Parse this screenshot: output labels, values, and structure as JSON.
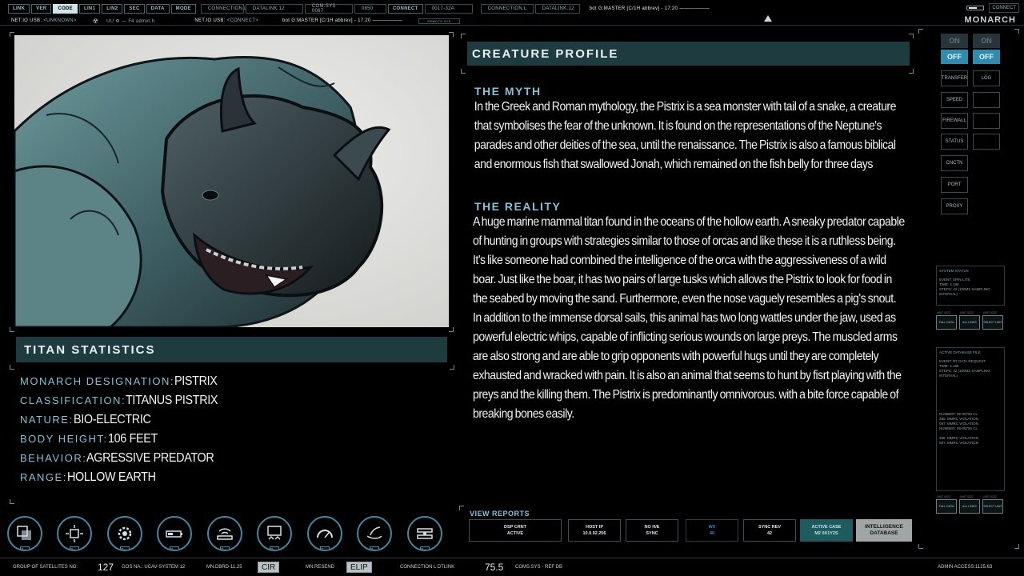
{
  "topbar": {
    "tabs": [
      "LINK",
      "VER",
      "CODE",
      "LIN1",
      "LIN2",
      "SEC",
      "DATA",
      "MODE"
    ],
    "active_tab": "CODE",
    "cells": [
      "CONNECTION.L",
      "DATALINK.12",
      "COM.SYS 0067",
      "0850",
      "CONNECT",
      "0017-32A"
    ],
    "cells_mid": [
      "CONNECTION.L",
      "DATALINK.12"
    ],
    "status_text": "bot G:MASTER [C/1H abbrev] - 17:20 ——————",
    "connect_label": "CONNECT",
    "row2": {
      "usb_label": "NET.IO USB:",
      "usb_value": "<UNKNOWN>",
      "radiation_glyph": "☢",
      "user_text": "UU  ⚙ — F4 admin.h",
      "usb2_label": "NET.IO USB:",
      "usb2_value": "<CONNECT>",
      "status_text": "bot G:MASTER [C/1H abbrev] - 17:20 ——————",
      "small_box": "REMOTE SYS"
    },
    "brand": "MONARCH"
  },
  "titan_stats": {
    "header": "TITAN STATISTICS",
    "rows": [
      {
        "label": "MONARCH DESIGNATION:",
        "value": "PISTRIX"
      },
      {
        "label": "CLASSIFICATION:",
        "value": "TITANUS PISTRIX"
      },
      {
        "label": "NATURE:",
        "value": "BIO-ELECTRIC"
      },
      {
        "label": "BODY HEIGHT:",
        "value": "106 FEET"
      },
      {
        "label": "BEHAVIOR:",
        "value": "AGRESSIVE PREDATOR"
      },
      {
        "label": "RANGE:",
        "value": "HOLLOW EARTH"
      }
    ]
  },
  "profile": {
    "header": "CREATURE PROFILE",
    "myth_title": "THE MYTH",
    "myth_text": "In the Greek and Roman mythology, the Pistrix is a sea monster with tail of a snake, a creature that symbolises the fear of the unknown. It is found on the representations of the Neptune's parades and other deities of the sea, until the renaissance. The Pistrix is also a famous biblical and enormous fish that swallowed Jonah, which remained on the fish belly for three days",
    "reality_title": "THE REALITY",
    "reality_text": "A huge marine mammal titan found in the oceans of the hollow earth. A sneaky predator capable of hunting in groups with strategies similar to those of orcas and like these it is a ruthless being. It's like someone had combined the intelligence of the orca with the aggressiveness of a wild boar. Just like the boar, it has two pairs of large tusks which allows the Pistrix to look for food in the seabed by moving the sand. Furthermore, even the nose vaguely resembles a pig's snout. In addition to the immense dorsal sails, this animal has two long wattles under the jaw, used as powerful electric whips, capable of inflicting serious wounds on large preys. The muscled arms are also strong and are able to grip opponents with powerful hugs until they are completely exhausted and wracked with pain. It is also an animal that seems to hunt by fisrt playing with the preys and the killing them. The Pistrix is predominantly omnivorous. with a bite force capable of breaking bones easily."
  },
  "controls": {
    "toggles": [
      {
        "on": "ON",
        "off": "OFF"
      },
      {
        "on": "ON",
        "off": "OFF"
      }
    ],
    "buttons": [
      "TRANSFER",
      "LOG",
      "SPEED",
      "FIREWALL",
      "STATUS",
      "CNCTN",
      "PORT",
      "PROXY"
    ],
    "info1": {
      "title": "SYSTEM STATUS",
      "lines": [
        "EVENT:      SPIN-LITE",
        "TIME:        4.185",
        "STEPS:      42 (100MS SAMPLING",
        "INTERVAL)"
      ]
    },
    "mini1": [
      "FULL DATA",
      "ALL LINKS",
      "SELECT UNIT"
    ],
    "mini_caps": "UNIT 0322",
    "info2": {
      "title": "ACTIVE DATABASE FILE",
      "lines": [
        "EVENT:      RT DATA REQUEST",
        "TIME:        4.185",
        "STEPS:      42 (100MS SAMPLING",
        "INTERVAL)",
        "",
        "",
        "",
        "",
        "",
        "",
        "NUMBER:   05-08755 CL",
        "385:          MMRC VIOLATION",
        "087:          MMRC VIOLATION",
        "NUMBER:   05-08756 CL",
        "",
        "385:          MMRC VIOLATION",
        "087:          MMRC VIOLATION"
      ]
    },
    "mini2": [
      "FULL DATA",
      "ALL LINKS",
      "SELECT UNIT"
    ]
  },
  "bottom_icons": {
    "labels": [
      "01",
      "02",
      "03",
      "04",
      "05",
      "06",
      "07",
      "08",
      "09"
    ]
  },
  "reports": {
    "title": "VIEW REPORTS",
    "items": [
      {
        "l1": "DSP CRNT",
        "l2": "ACTIVE",
        "style": ""
      },
      {
        "l1": "HOST IP",
        "l2": "10.0.92.256",
        "style": ""
      },
      {
        "l1": "NO H/E",
        "l2": "SYNC",
        "style": ""
      },
      {
        "l1": "WX",
        "l2": "40",
        "style": "dim"
      },
      {
        "l1": "SYNC REV",
        "l2": "42",
        "style": ""
      },
      {
        "l1": "ACTIVE CASE",
        "l2": "M2 0X1Y2S",
        "style": "teal"
      },
      {
        "l1": "INTELLIGENCE",
        "l2": "DATABASE",
        "style": "grey"
      }
    ]
  },
  "bottombar": {
    "satellites_label": "GROUP OF SATELLITES NO:",
    "satellites_value": "127",
    "gos_label": "GOS NA.: UCAV-SYSTEM 12",
    "mn1": "MN.DBRD-11.25",
    "tag1": "CIR",
    "mn2": "MN.RESEND",
    "tag2": "ELIP",
    "conn": "CONNECTION L DTLINK",
    "value2": "75.5",
    "coms": "COMS.SYS - REF DB",
    "admin": "ADMIN ACCESS:1125.63"
  }
}
